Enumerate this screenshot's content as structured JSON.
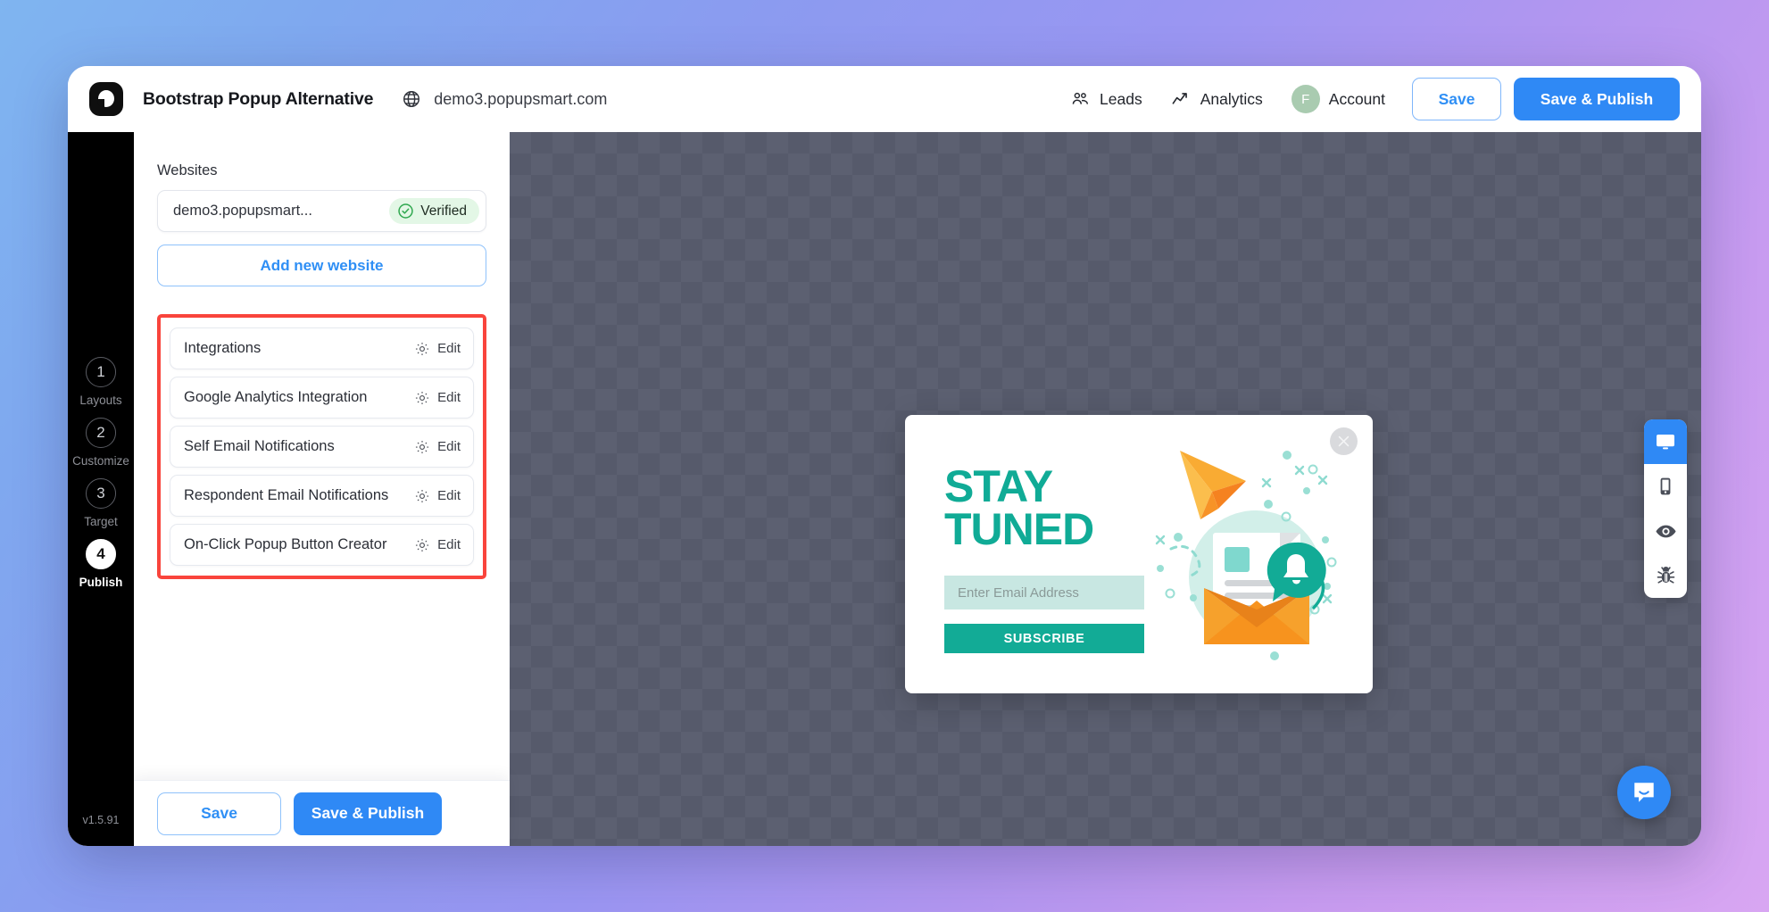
{
  "header": {
    "logo_icon": "popupsmart-logo-icon",
    "title": "Bootstrap Popup Alternative",
    "globe_icon": "globe-icon",
    "domain": "demo3.popupsmart.com",
    "leads_label": "Leads",
    "leads_icon": "leads-people-icon",
    "analytics_label": "Analytics",
    "analytics_icon": "analytics-trend-icon",
    "account_label": "Account",
    "account_initial": "F",
    "save_label": "Save",
    "publish_label": "Save & Publish"
  },
  "steps": {
    "items": [
      {
        "number": "1",
        "label": "Layouts",
        "active": false
      },
      {
        "number": "2",
        "label": "Customize",
        "active": false
      },
      {
        "number": "3",
        "label": "Target",
        "active": false
      },
      {
        "number": "4",
        "label": "Publish",
        "active": true
      }
    ],
    "version": "v1.5.91"
  },
  "panel": {
    "websites_label": "Websites",
    "website_name": "demo3.popupsmart...",
    "verified_label": "Verified",
    "verified_icon": "check-circle-icon",
    "add_website_label": "Add new website",
    "integrations": [
      {
        "name": "Integrations",
        "edit_label": "Edit",
        "icon": "gear-icon"
      },
      {
        "name": "Google Analytics Integration",
        "edit_label": "Edit",
        "icon": "gear-icon"
      },
      {
        "name": "Self Email Notifications",
        "edit_label": "Edit",
        "icon": "gear-icon"
      },
      {
        "name": "Respondent Email Notifications",
        "edit_label": "Edit",
        "icon": "gear-icon"
      },
      {
        "name": "On-Click Popup Button Creator",
        "edit_label": "Edit",
        "icon": "gear-icon"
      }
    ],
    "footer_save_label": "Save",
    "footer_publish_label": "Save & Publish"
  },
  "popup": {
    "close_icon": "close-icon",
    "heading_line1": "STAY",
    "heading_line2": "TUNED",
    "email_placeholder": "Enter Email Address",
    "subscribe_label": "SUBSCRIBE",
    "artwork_icon": "email-paper-plane-illustration"
  },
  "device_bar": {
    "items": [
      {
        "icon": "desktop-icon",
        "selected": true,
        "dot": "green"
      },
      {
        "icon": "mobile-icon",
        "selected": false,
        "dot": "red"
      },
      {
        "icon": "eye-preview-icon",
        "selected": false,
        "dot": ""
      },
      {
        "icon": "bug-debug-icon",
        "selected": false,
        "dot": ""
      }
    ]
  },
  "chat": {
    "icon": "chat-bubble-icon"
  },
  "colors": {
    "accent_blue": "#2f89f5",
    "highlight_red": "#f9443c",
    "verified_green": "#2fa84f",
    "popup_teal": "#12ab96",
    "rail_black": "#000000"
  }
}
